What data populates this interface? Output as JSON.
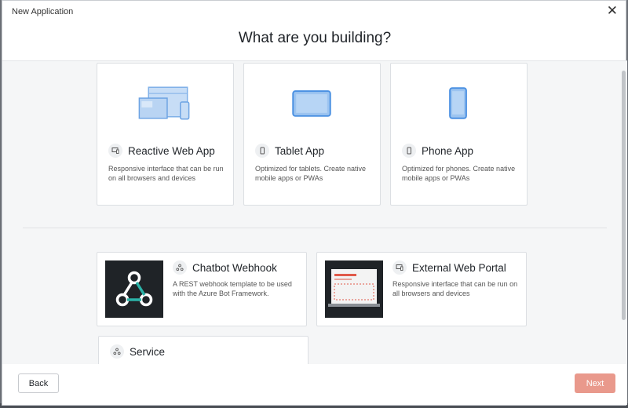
{
  "dialog": {
    "title": "New Application",
    "heading": "What are you building?"
  },
  "app_types": [
    {
      "title": "Reactive Web App",
      "description": "Responsive interface that can be run on all browsers and devices",
      "icon": "desktop-icon"
    },
    {
      "title": "Tablet App",
      "description": "Optimized for tablets. Create native mobile apps or PWAs",
      "icon": "phone-icon"
    },
    {
      "title": "Phone App",
      "description": "Optimized for phones. Create native mobile apps or PWAs",
      "icon": "phone-icon"
    }
  ],
  "templates": [
    {
      "title": "Chatbot Webhook",
      "description": "A REST webhook template to be used with the Azure Bot Framework.",
      "icon": "webhook-icon"
    },
    {
      "title": "External Web Portal",
      "description": "Responsive interface that can be run on all browsers and devices",
      "icon": "desktop-icon"
    },
    {
      "title": "Service",
      "icon": "webhook-icon"
    }
  ],
  "footer": {
    "back_label": "Back",
    "next_label": "Next"
  },
  "colors": {
    "accent_blue": "#4a90e2",
    "next_button": "#e9998c"
  }
}
